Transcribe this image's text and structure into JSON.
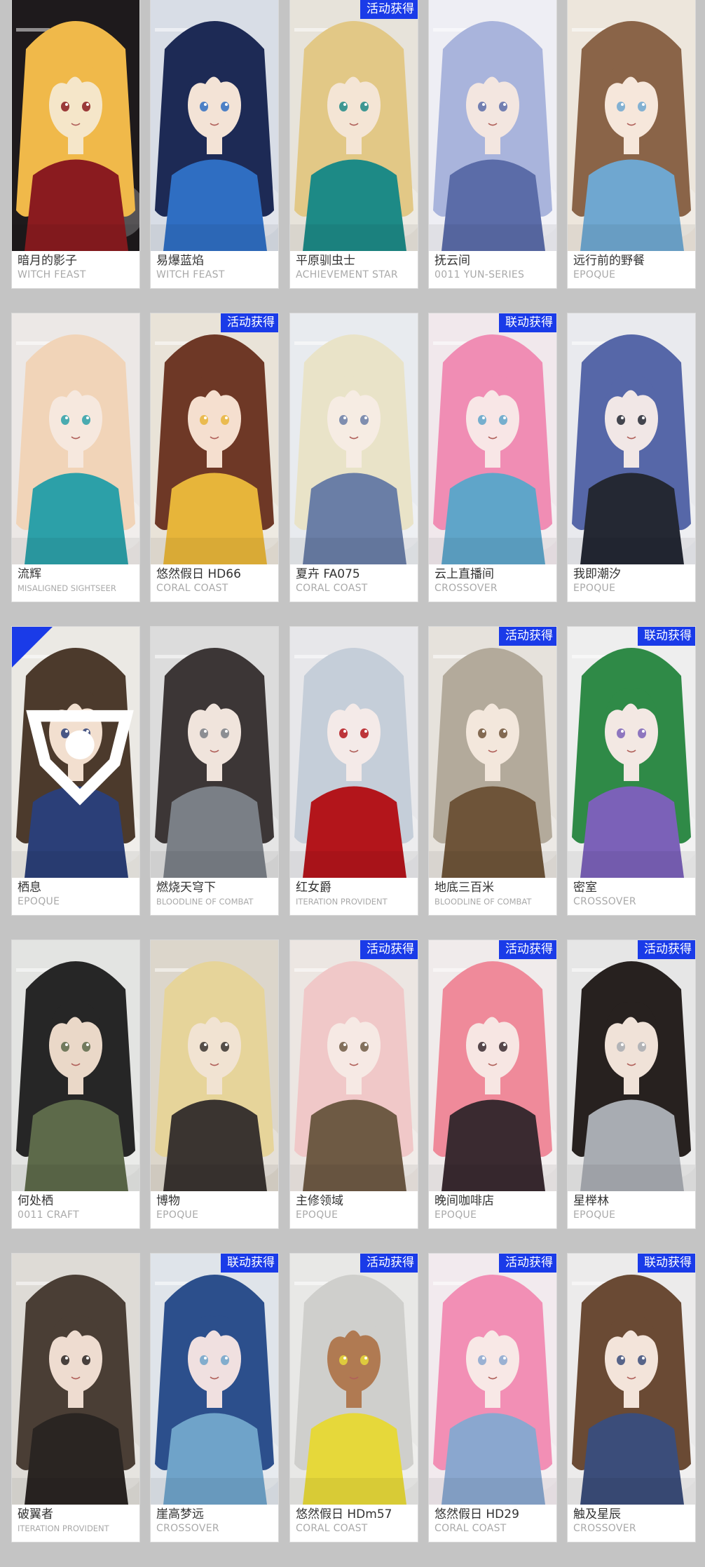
{
  "badge_color": "#1a3be8",
  "cards": [
    {
      "name": "暗月的影子",
      "series": "WITCH FEAST",
      "badge": "",
      "palette": [
        "#1e1a1c",
        "#f0b94a",
        "#f5e6c9",
        "#8a1b1f"
      ]
    },
    {
      "name": "易爆蓝焰",
      "series": "WITCH FEAST",
      "badge": "",
      "palette": [
        "#d8dde6",
        "#1d2a55",
        "#f3e3d6",
        "#2f6ec2"
      ]
    },
    {
      "name": "平原驯虫士",
      "series": "ACHIEVEMENT STAR",
      "badge": "活动获得",
      "palette": [
        "#e7e3da",
        "#e2c886",
        "#f4e5d5",
        "#1d8a86"
      ]
    },
    {
      "name": "抚云间",
      "series": "0011 YUN-SERIES",
      "badge": "",
      "palette": [
        "#eeeef4",
        "#a9b4dc",
        "#f3e6e0",
        "#5b6ca8"
      ]
    },
    {
      "name": "远行前的野餐",
      "series": "EPOQUE",
      "badge": "",
      "palette": [
        "#ede6dc",
        "#8a6448",
        "#f6e7db",
        "#6fa7d0"
      ]
    },
    {
      "name": "流辉",
      "series": "MISALIGNED SIGHTSEER",
      "badge": "",
      "palette": [
        "#ece8e6",
        "#f1d4b8",
        "#f6e8de",
        "#2ca0a8"
      ]
    },
    {
      "name": "悠然假日 HD66",
      "series": "CORAL COAST",
      "badge": "活动获得",
      "palette": [
        "#e9e3d8",
        "#6e3826",
        "#f5dfcf",
        "#e7b53a"
      ]
    },
    {
      "name": "夏卉 FA075",
      "series": "CORAL COAST",
      "badge": "",
      "palette": [
        "#e8ebef",
        "#e9e3c8",
        "#f6ece3",
        "#6a7ea6"
      ]
    },
    {
      "name": "云上直播间",
      "series": "CROSSOVER",
      "badge": "联动获得",
      "palette": [
        "#f1e8ec",
        "#f08db4",
        "#f8e6e6",
        "#5fa5c9"
      ]
    },
    {
      "name": "我即潮汐",
      "series": "EPOQUE",
      "badge": "",
      "palette": [
        "#e9eaee",
        "#5667a8",
        "#f1e7e6",
        "#242833"
      ]
    },
    {
      "name": "栖息",
      "series": "EPOQUE",
      "badge": "",
      "corner": true,
      "palette": [
        "#ebe9e4",
        "#4c3a2c",
        "#f2dfcf",
        "#2b3f78"
      ]
    },
    {
      "name": "燃烧天穹下",
      "series": "BLOODLINE OF COMBAT",
      "badge": "",
      "palette": [
        "#dcdcdc",
        "#3c3636",
        "#f0e4dc",
        "#7a7f86"
      ]
    },
    {
      "name": "红女爵",
      "series": "ITERATION PROVIDENT",
      "badge": "",
      "palette": [
        "#e7e7ea",
        "#c5ced9",
        "#f4eae8",
        "#b3151b"
      ]
    },
    {
      "name": "地底三百米",
      "series": "BLOODLINE OF COMBAT",
      "badge": "活动获得",
      "palette": [
        "#e6e2dc",
        "#b3aa9b",
        "#f3e7dc",
        "#6e5439"
      ]
    },
    {
      "name": "密室",
      "series": "CROSSOVER",
      "badge": "联动获得",
      "palette": [
        "#eeeeee",
        "#2f8a47",
        "#f3e8e3",
        "#7b61b8"
      ]
    },
    {
      "name": "何处栖",
      "series": "0011 CRAFT",
      "badge": "",
      "palette": [
        "#e3e4e2",
        "#262626",
        "#ead8c8",
        "#5d6a4a"
      ]
    },
    {
      "name": "博物",
      "series": "EPOQUE",
      "badge": "",
      "palette": [
        "#dcd6cb",
        "#e6d49a",
        "#f1e3d2",
        "#3a3430"
      ]
    },
    {
      "name": "主修领域",
      "series": "EPOQUE",
      "badge": "活动获得",
      "palette": [
        "#ece6e2",
        "#f0c8c8",
        "#f6e9e4",
        "#6e5a44"
      ]
    },
    {
      "name": "晚间咖啡店",
      "series": "EPOQUE",
      "badge": "活动获得",
      "palette": [
        "#f0ebeb",
        "#ef8a9a",
        "#f7e6e3",
        "#3a2a30"
      ]
    },
    {
      "name": "星榉林",
      "series": "EPOQUE",
      "badge": "活动获得",
      "palette": [
        "#e6e6e6",
        "#27211f",
        "#f0e2d8",
        "#a8acb2"
      ]
    },
    {
      "name": "破翼者",
      "series": "ITERATION PROVIDENT",
      "badge": "",
      "palette": [
        "#dedbd6",
        "#4a3e35",
        "#eedcd0",
        "#2a2522"
      ]
    },
    {
      "name": "崖高梦远",
      "series": "CROSSOVER",
      "badge": "联动获得",
      "palette": [
        "#dfe4ea",
        "#2c4f8c",
        "#f0e0e0",
        "#6fa3c9"
      ]
    },
    {
      "name": "悠然假日 HDm57",
      "series": "CORAL COAST",
      "badge": "活动获得",
      "palette": [
        "#e8e8e6",
        "#cfcfcc",
        "#b07a52",
        "#e6d83a"
      ]
    },
    {
      "name": "悠然假日 HD29",
      "series": "CORAL COAST",
      "badge": "活动获得",
      "palette": [
        "#f2eaee",
        "#f28fb5",
        "#f8e8e6",
        "#8aa7cf"
      ]
    },
    {
      "name": "触及星辰",
      "series": "CROSSOVER",
      "badge": "联动获得",
      "palette": [
        "#ecebeb",
        "#6a4a34",
        "#f3e4da",
        "#3b4d7a"
      ]
    }
  ]
}
